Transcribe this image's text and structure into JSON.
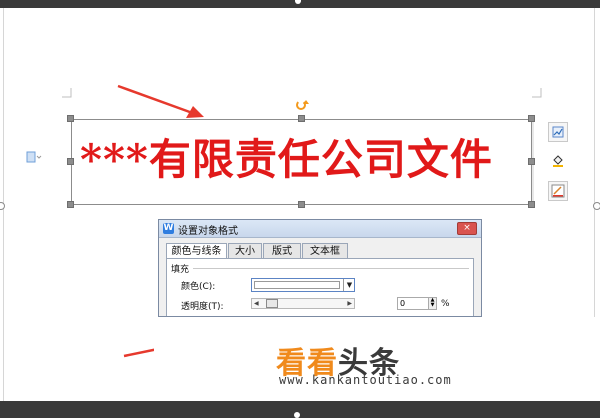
{
  "textbox": {
    "text": "***有限责任公司文件",
    "color": "#e11919"
  },
  "dialog": {
    "title": "设置对象格式",
    "close_symbol": "×",
    "tabs": [
      {
        "label": "颜色与线条",
        "active": true
      },
      {
        "label": "大小",
        "active": false
      },
      {
        "label": "版式",
        "active": false
      },
      {
        "label": "文本框",
        "active": false
      }
    ],
    "section_fill": "填充",
    "color_label": "颜色(C):",
    "transparency_label": "透明度(T):",
    "transparency_value": "0",
    "percent": "%",
    "dropdown_arrow": "▼"
  },
  "watermark": {
    "brand_part1": "看看",
    "brand_part2": "头条",
    "url": "www.kankantoutiao.com"
  },
  "colors": {
    "arrow": "#e6392d",
    "accent_orange": "#f08a1c",
    "handle_gray": "#8d8d8d"
  },
  "icons": [
    "layout-options-icon",
    "fill-bucket-icon",
    "outline-pen-icon",
    "rotate-handle-icon",
    "document-icon"
  ]
}
